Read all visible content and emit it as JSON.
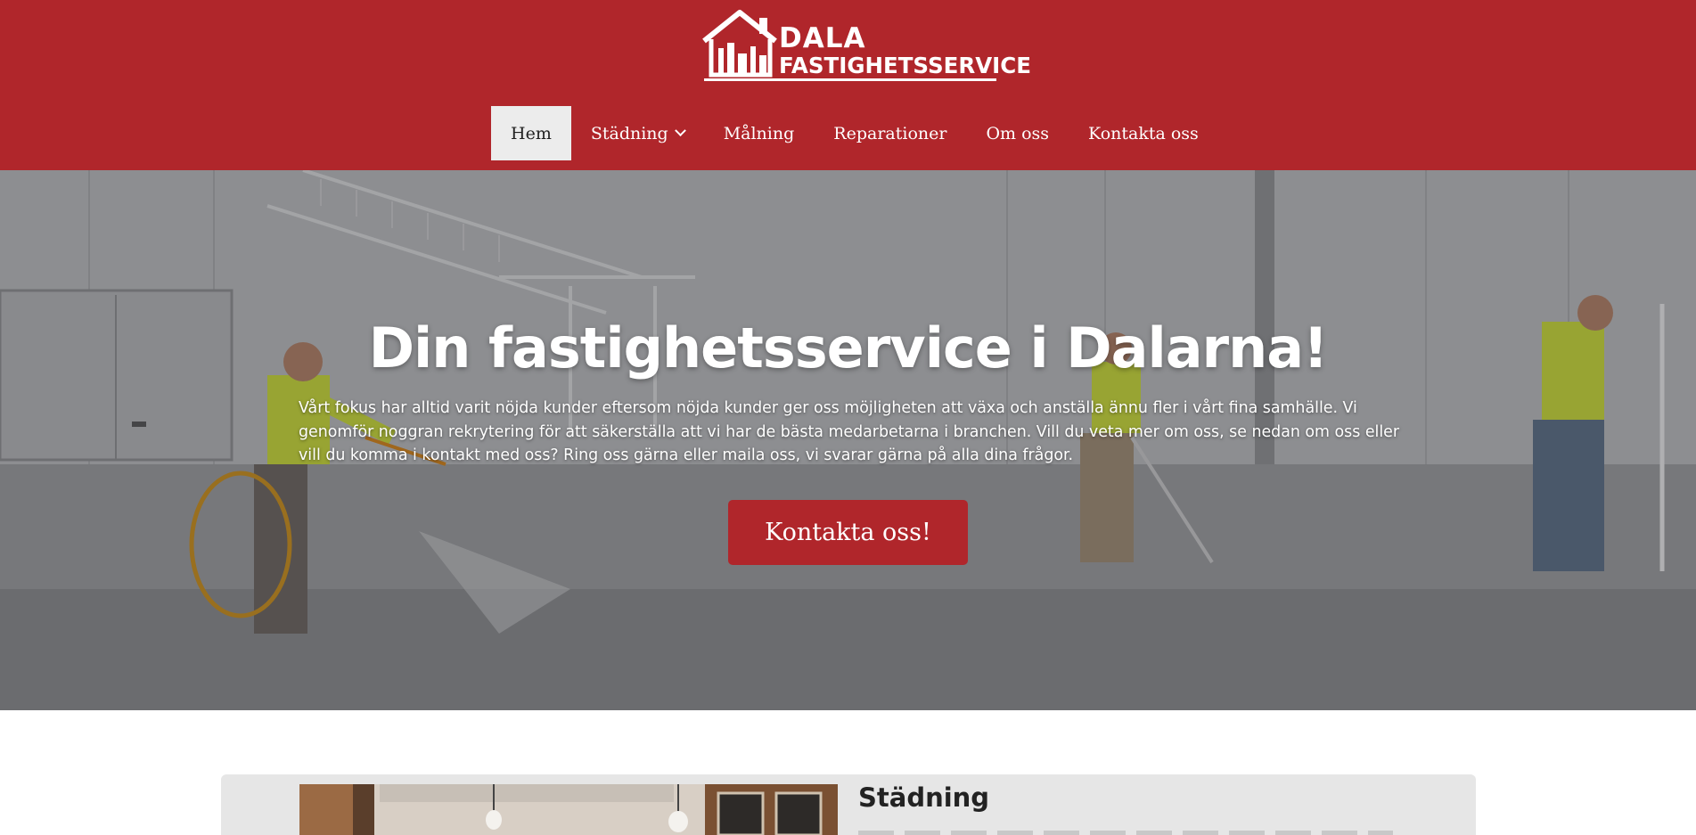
{
  "header": {
    "logo_line1": "DALA",
    "logo_line2": "FASTIGHETSSERVICE",
    "bg_color": "#b0262b"
  },
  "nav": {
    "items": [
      {
        "label": "Hem",
        "active": true
      },
      {
        "label": "Städning",
        "has_dropdown": true
      },
      {
        "label": "Målning"
      },
      {
        "label": "Reparationer"
      },
      {
        "label": "Om oss"
      },
      {
        "label": "Kontakta oss"
      }
    ]
  },
  "hero": {
    "title": "Din fastighetsservice i Dalarna!",
    "text": "Vårt fokus har alltid varit nöjda kunder eftersom nöjda kunder ger oss möjligheten att växa och anställa ännu fler i vårt fina samhälle. Vi genomför noggran rekrytering för att säkerställa att vi har de bästa medarbetarna i branchen. Vill du veta mer om oss, se nedan om oss eller vill du komma i kontakt med oss? Ring oss gärna eller maila oss, vi svarar gärna på alla dina frågor.",
    "button_label": "Kontakta oss!"
  },
  "services": {
    "first_title": "Städning"
  },
  "icons": [
    "house-logo-icon",
    "chevron-down-icon"
  ],
  "colors": {
    "accent": "#b0262b",
    "active_nav_bg": "#ececec"
  }
}
